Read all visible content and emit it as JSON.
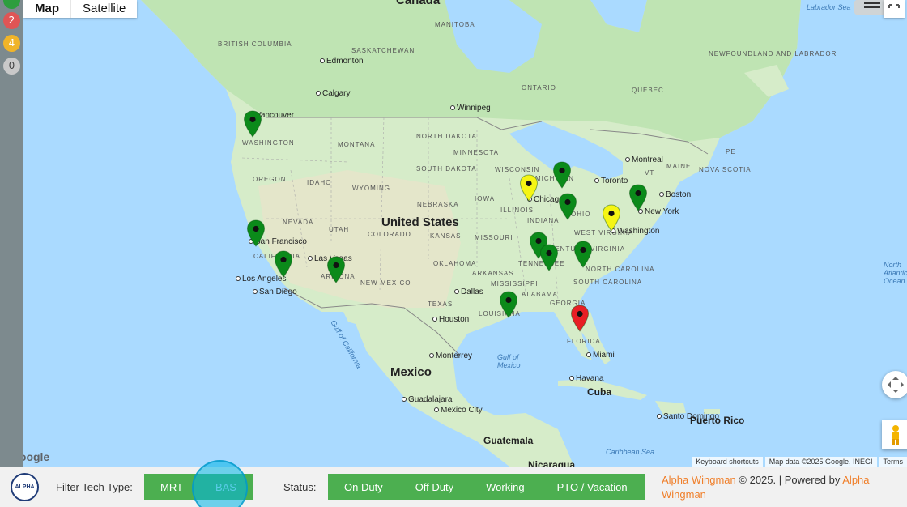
{
  "left_rail": {
    "badges": [
      {
        "label": "",
        "color": "#2e9e3e"
      },
      {
        "label": "2",
        "color": "#e05555"
      },
      {
        "label": "4",
        "color": "#f0b429"
      },
      {
        "label": "0",
        "color": "#c9c9c9"
      }
    ]
  },
  "map": {
    "type_toggle": {
      "map_label": "Map",
      "satellite_label": "Satellite"
    },
    "countries": [
      "Canada",
      "United States",
      "Mexico",
      "Cuba",
      "Puerto Rico",
      "Guatemala",
      "Nicaragua"
    ],
    "regions": [
      "BRITISH COLUMBIA",
      "SASKATCHEWAN",
      "MANITOBA",
      "ONTARIO",
      "QUEBEC",
      "NEWFOUNDLAND AND LABRADOR",
      "WASHINGTON",
      "OREGON",
      "IDAHO",
      "MONTANA",
      "WYOMING",
      "NORTH DAKOTA",
      "SOUTH DAKOTA",
      "NEBRASKA",
      "KANSAS",
      "COLORADO",
      "UTAH",
      "NEVADA",
      "CALIFORNIA",
      "ARIZONA",
      "NEW MEXICO",
      "TEXAS",
      "OKLAHOMA",
      "MINNESOTA",
      "IOWA",
      "MISSOURI",
      "ARKANSAS",
      "LOUISIANA",
      "MISSISSIPPI",
      "ALABAMA",
      "TENNESSEE",
      "KENTUCKY",
      "ILLINOIS",
      "INDIANA",
      "OHIO",
      "MICHIGAN",
      "WISCONSIN",
      "WEST VIRGINIA",
      "VIRGINIA",
      "NORTH CAROLINA",
      "SOUTH CAROLINA",
      "GEORGIA",
      "FLORIDA",
      "MAINE",
      "VT",
      "NOVA SCOTIA",
      "PE"
    ],
    "cities": [
      "Edmonton",
      "Calgary",
      "Vancouver",
      "Winnipeg",
      "Montreal",
      "Toronto",
      "Boston",
      "New York",
      "Washington",
      "Chicago",
      "Dallas",
      "Houston",
      "San Francisco",
      "Las Vegas",
      "Los Angeles",
      "San Diego",
      "Monterrey",
      "Guadalajara",
      "Mexico City",
      "Havana",
      "Miami",
      "Santo Domingo"
    ],
    "water": [
      "Labrador Sea",
      "Gulf of Mexico",
      "Gulf of California",
      "Caribbean Sea",
      "North Atlantic Ocean"
    ],
    "google_logo": "Google",
    "attribution": [
      "Keyboard shortcuts",
      "Map data ©2025 Google, INEGI",
      "Terms"
    ],
    "markers": [
      {
        "name": "marker-seattle",
        "status": "green"
      },
      {
        "name": "marker-san-francisco",
        "status": "green"
      },
      {
        "name": "marker-los-angeles",
        "status": "green"
      },
      {
        "name": "marker-phoenix",
        "status": "green"
      },
      {
        "name": "marker-chicago",
        "status": "yellow"
      },
      {
        "name": "marker-michigan",
        "status": "green"
      },
      {
        "name": "marker-ohio",
        "status": "green"
      },
      {
        "name": "marker-new-york",
        "status": "green"
      },
      {
        "name": "marker-washington-dc",
        "status": "yellow"
      },
      {
        "name": "marker-nashville",
        "status": "green"
      },
      {
        "name": "marker-tennessee",
        "status": "green"
      },
      {
        "name": "marker-north-carolina",
        "status": "green"
      },
      {
        "name": "marker-louisiana",
        "status": "green"
      },
      {
        "name": "marker-florida",
        "status": "red"
      }
    ],
    "status_colors": {
      "green": "#0b8a1a",
      "yellow": "#f5f514",
      "red": "#e81e25"
    }
  },
  "footer": {
    "logo_text": "ALPHA",
    "filter_label": "Filter Tech Type:",
    "tech_buttons": [
      "MRT",
      "BAS"
    ],
    "status_label": "Status:",
    "status_buttons": [
      "On Duty",
      "Off Duty",
      "Working",
      "PTO / Vacation"
    ],
    "credits": {
      "brand": "Alpha Wingman",
      "middle": " © 2025. | Powered by ",
      "powered_by": "Alpha Wingman"
    }
  },
  "colors": {
    "accent_green": "#4caf50",
    "link_orange": "#f07f2a"
  }
}
